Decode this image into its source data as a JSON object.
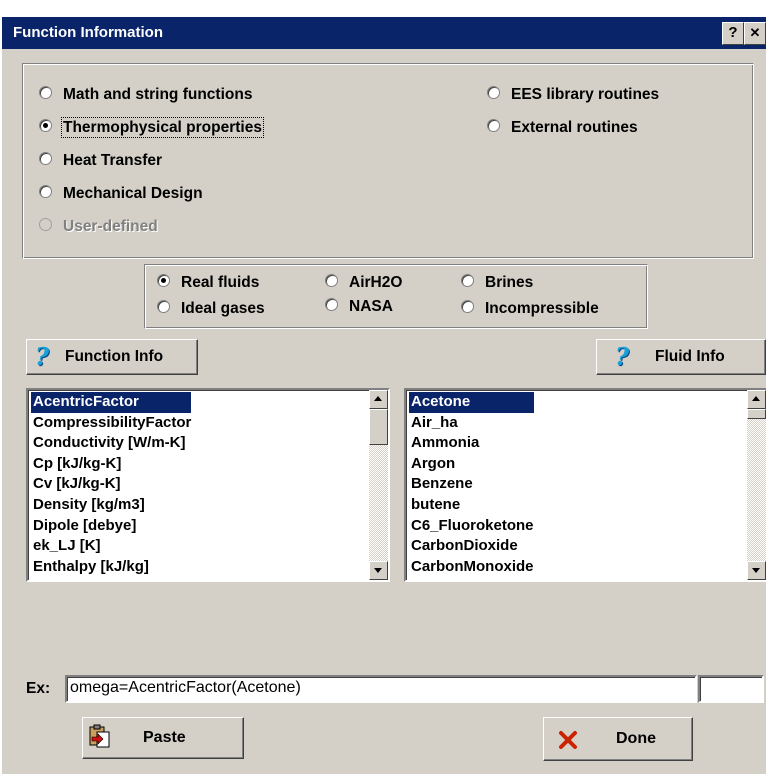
{
  "window": {
    "title": "Function Information",
    "help_label": "?",
    "close_label": "✕"
  },
  "categories": [
    {
      "label": "Math and string functions",
      "selected": false,
      "enabled": true
    },
    {
      "label": "Thermophysical properties",
      "selected": true,
      "enabled": true
    },
    {
      "label": "Heat Transfer",
      "selected": false,
      "enabled": true
    },
    {
      "label": "Mechanical Design",
      "selected": false,
      "enabled": true
    },
    {
      "label": "User-defined",
      "selected": false,
      "enabled": false
    },
    {
      "label": "EES library routines",
      "selected": false,
      "enabled": true
    },
    {
      "label": "External routines",
      "selected": false,
      "enabled": true
    }
  ],
  "fluid_types": [
    {
      "label": "Real fluids",
      "selected": true
    },
    {
      "label": "AirH2O",
      "selected": false
    },
    {
      "label": "Brines",
      "selected": false
    },
    {
      "label": "Ideal gases",
      "selected": false
    },
    {
      "label": "NASA",
      "selected": false
    },
    {
      "label": "Incompressible",
      "selected": false
    }
  ],
  "buttons": {
    "function_info": "Function Info",
    "fluid_info": "Fluid Info",
    "paste": "Paste",
    "done": "Done"
  },
  "functions": {
    "selected_index": 0,
    "items": [
      "AcentricFactor",
      "CompressibilityFactor",
      "Conductivity [W/m-K]",
      "Cp [kJ/kg-K]",
      "Cv [kJ/kg-K]",
      "Density [kg/m3]",
      "Dipole [debye]",
      "ek_LJ [K]",
      "Enthalpy [kJ/kg]"
    ]
  },
  "fluids": {
    "selected_index": 0,
    "items": [
      "Acetone",
      "Air_ha",
      "Ammonia",
      "Argon",
      "Benzene",
      "butene",
      "C6_Fluoroketone",
      "CarbonDioxide",
      "CarbonMonoxide"
    ]
  },
  "example": {
    "label": "Ex:",
    "value": "omega=AcentricFactor(Acetone)"
  },
  "colors": {
    "title_bar": "#0a246a",
    "dialog_face": "#d4d0c8",
    "selection": "#0a246a",
    "help_icon": "#1aa0d8",
    "done_x": "#cc2200"
  },
  "icons": {
    "help": "question-mark-icon",
    "paste": "paste-clipboard-icon",
    "done": "red-x-icon"
  }
}
